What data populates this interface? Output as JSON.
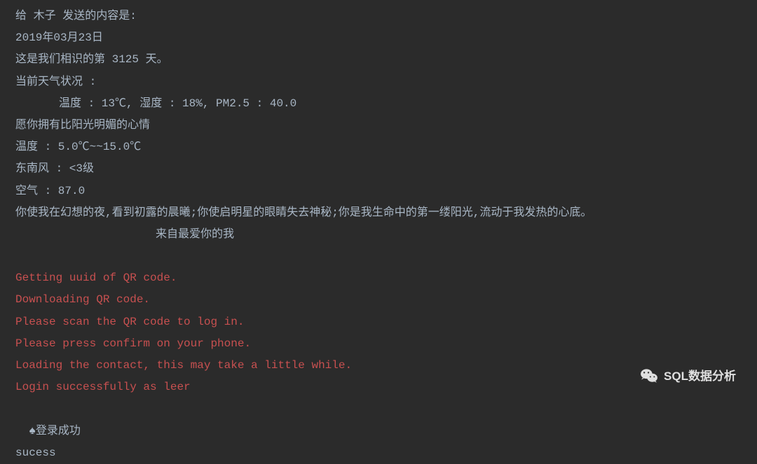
{
  "terminal": {
    "lines": [
      {
        "text": "给 木子 发送的内容是:",
        "class": "output-line"
      },
      {
        "text": "2019年03月23日",
        "class": "output-line"
      },
      {
        "text": "这是我们相识的第 3125 天。",
        "class": "output-line"
      },
      {
        "text": "当前天气状况 :",
        "class": "output-line"
      },
      {
        "text": "温度 : 13℃, 湿度 : 18%, PM2.5 : 40.0",
        "class": "output-line indent"
      },
      {
        "text": "愿你拥有比阳光明媚的心情",
        "class": "output-line"
      },
      {
        "text": "温度 : 5.0℃~~15.0℃",
        "class": "output-line"
      },
      {
        "text": "东南风 : <3级",
        "class": "output-line"
      },
      {
        "text": "空气 : 87.0",
        "class": "output-line"
      },
      {
        "text": "你使我在幻想的夜,看到初露的晨曦;你使启明星的眼睛失去神秘;你是我生命中的第一缕阳光,流动于我发热的心底。",
        "class": "output-line"
      },
      {
        "text": "来自最爱你的我",
        "class": "output-line indent2"
      },
      {
        "text": " ",
        "class": "output-line"
      },
      {
        "text": "Getting uuid of QR code.",
        "class": "red-line"
      },
      {
        "text": "Downloading QR code.",
        "class": "red-line"
      },
      {
        "text": "Please scan the QR code to log in.",
        "class": "red-line"
      },
      {
        "text": "Please press confirm on your phone.",
        "class": "red-line"
      },
      {
        "text": "Loading the contact, this may take a little while.",
        "class": "red-line"
      },
      {
        "text": "Login successfully as leer",
        "class": "red-line"
      }
    ],
    "login_success_prefix": "♠",
    "login_success_text": "登录成功",
    "success_text": "sucess"
  },
  "watermark": {
    "text": "SQL数据分析"
  }
}
